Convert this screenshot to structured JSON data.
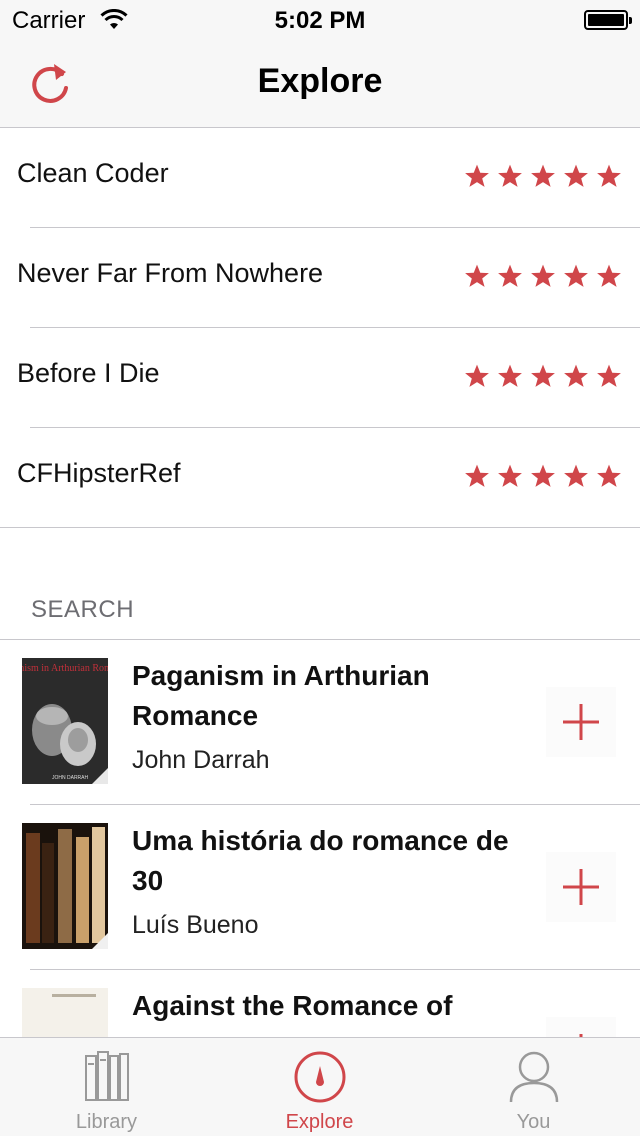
{
  "status_bar": {
    "carrier": "Carrier",
    "time": "5:02 PM"
  },
  "nav": {
    "title": "Explore",
    "refresh_icon": "refresh-icon"
  },
  "colors": {
    "accent": "#d0464a",
    "separator": "#c8c7cc",
    "tab_inactive": "#999999"
  },
  "explore_list": [
    {
      "title": "Clean Coder",
      "rating": 5
    },
    {
      "title": "Never Far From Nowhere",
      "rating": 5
    },
    {
      "title": "Before I Die",
      "rating": 5
    },
    {
      "title": "CFHipsterRef",
      "rating": 5
    }
  ],
  "search": {
    "header": "SEARCH",
    "results": [
      {
        "title": "Paganism in Arthurian Romance",
        "author": "John Darrah",
        "cover_text": "Paganism in Arthurian Romance",
        "cover_author": "JOHN DARRAH"
      },
      {
        "title": "Uma história do romance de 30",
        "author": "Luís Bueno"
      },
      {
        "title": "Against the Romance of",
        "author": ""
      }
    ]
  },
  "tabs": [
    {
      "label": "Library",
      "icon": "library-icon",
      "active": false
    },
    {
      "label": "Explore",
      "icon": "compass-icon",
      "active": true
    },
    {
      "label": "You",
      "icon": "person-icon",
      "active": false
    }
  ]
}
